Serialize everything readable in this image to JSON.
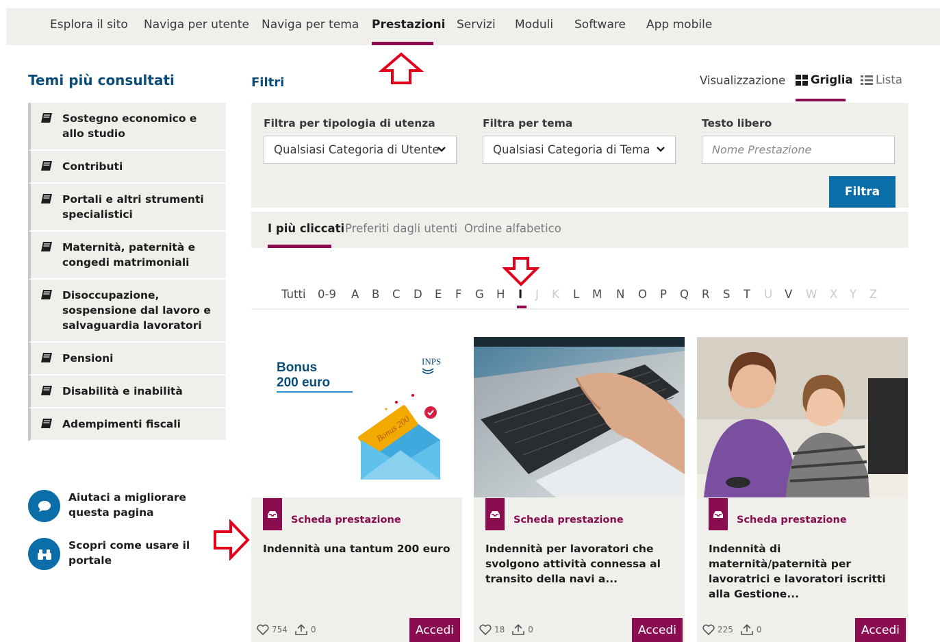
{
  "topnav": {
    "items": [
      {
        "label": "Esplora il sito"
      },
      {
        "label": "Naviga per utente"
      },
      {
        "label": "Naviga per tema"
      },
      {
        "label": "Prestazioni"
      },
      {
        "label": "Servizi"
      },
      {
        "label": "Moduli"
      },
      {
        "label": "Software"
      },
      {
        "label": "App mobile"
      }
    ],
    "active": "Prestazioni"
  },
  "sidebar": {
    "title": "Temi più consultati",
    "items": [
      {
        "label": "Sostegno economico e allo studio"
      },
      {
        "label": "Contributi"
      },
      {
        "label": "Portali e altri strumenti specialistici"
      },
      {
        "label": "Maternità, paternità e congedi matrimoniali"
      },
      {
        "label": "Disoccupazione, sospensione dal lavoro e salvaguardia lavoratori"
      },
      {
        "label": "Pensioni"
      },
      {
        "label": "Disabilità e inabilità"
      },
      {
        "label": "Adempimenti fiscali"
      }
    ],
    "help": [
      {
        "label": "Aiutaci a migliorare questa pagina",
        "icon": "chat-bubble-icon"
      },
      {
        "label": "Scopri come usare il portale",
        "icon": "binoculars-icon"
      }
    ]
  },
  "filters": {
    "title": "Filtri",
    "view_label": "Visualizzazione",
    "view_grid": "Griglia",
    "view_list": "Lista",
    "user_type_label": "Filtra per tipologia di utenza",
    "user_type_value": "Qualsiasi Categoria di Utente",
    "theme_label": "Filtra per tema",
    "theme_value": "Qualsiasi Categoria di Tema",
    "free_text_label": "Testo libero",
    "free_text_placeholder": "Nome Prestazione",
    "submit_label": "Filtra"
  },
  "sort_tabs": {
    "items": [
      {
        "label": "I più cliccati"
      },
      {
        "label": "Preferiti dagli utenti"
      },
      {
        "label": "Ordine alfabetico"
      }
    ],
    "active": "I più cliccati"
  },
  "alphabet": {
    "items": [
      {
        "label": "Tutti",
        "enabled": true
      },
      {
        "label": "0-9",
        "enabled": true
      },
      {
        "label": "A",
        "enabled": true
      },
      {
        "label": "B",
        "enabled": true
      },
      {
        "label": "C",
        "enabled": true
      },
      {
        "label": "D",
        "enabled": true
      },
      {
        "label": "E",
        "enabled": true
      },
      {
        "label": "F",
        "enabled": true
      },
      {
        "label": "G",
        "enabled": true
      },
      {
        "label": "H",
        "enabled": true
      },
      {
        "label": "I",
        "enabled": true
      },
      {
        "label": "J",
        "enabled": false
      },
      {
        "label": "K",
        "enabled": false
      },
      {
        "label": "L",
        "enabled": true
      },
      {
        "label": "M",
        "enabled": true
      },
      {
        "label": "N",
        "enabled": true
      },
      {
        "label": "O",
        "enabled": true
      },
      {
        "label": "P",
        "enabled": true
      },
      {
        "label": "Q",
        "enabled": true
      },
      {
        "label": "R",
        "enabled": true
      },
      {
        "label": "S",
        "enabled": true
      },
      {
        "label": "T",
        "enabled": true
      },
      {
        "label": "U",
        "enabled": false
      },
      {
        "label": "V",
        "enabled": true
      },
      {
        "label": "W",
        "enabled": false
      },
      {
        "label": "X",
        "enabled": false
      },
      {
        "label": "Y",
        "enabled": false
      },
      {
        "label": "Z",
        "enabled": false
      }
    ],
    "active": "I"
  },
  "cards": [
    {
      "tag": "Scheda prestazione",
      "title": "Indennità una tantum 200 euro",
      "likes": "754",
      "shares": "0",
      "button": "Accedi",
      "image": {
        "heading_line1": "Bonus",
        "heading_line2": "200 euro",
        "logo": "INPS",
        "ticket_text": "Bonus 200"
      }
    },
    {
      "tag": "Scheda prestazione",
      "title": "Indennità per lavoratori che svolgono attività connessa al transito della navi a...",
      "likes": "18",
      "shares": "0",
      "button": "Accedi",
      "image": {
        "subject": "laptop-keyboard-photo"
      }
    },
    {
      "tag": "Scheda prestazione",
      "title": "Indennità di maternità/paternità per lavoratrici e lavoratori iscritti alla Gestione...",
      "likes": "225",
      "shares": "0",
      "button": "Accedi",
      "image": {
        "subject": "mother-daughter-computer-photo"
      }
    }
  ],
  "colors": {
    "accent": "#8a0d4f",
    "primary_blue": "#0b6ea8",
    "title_blue": "#0b4d78",
    "panel_bg": "#f0efec",
    "annotation_red": "#e3001b"
  }
}
